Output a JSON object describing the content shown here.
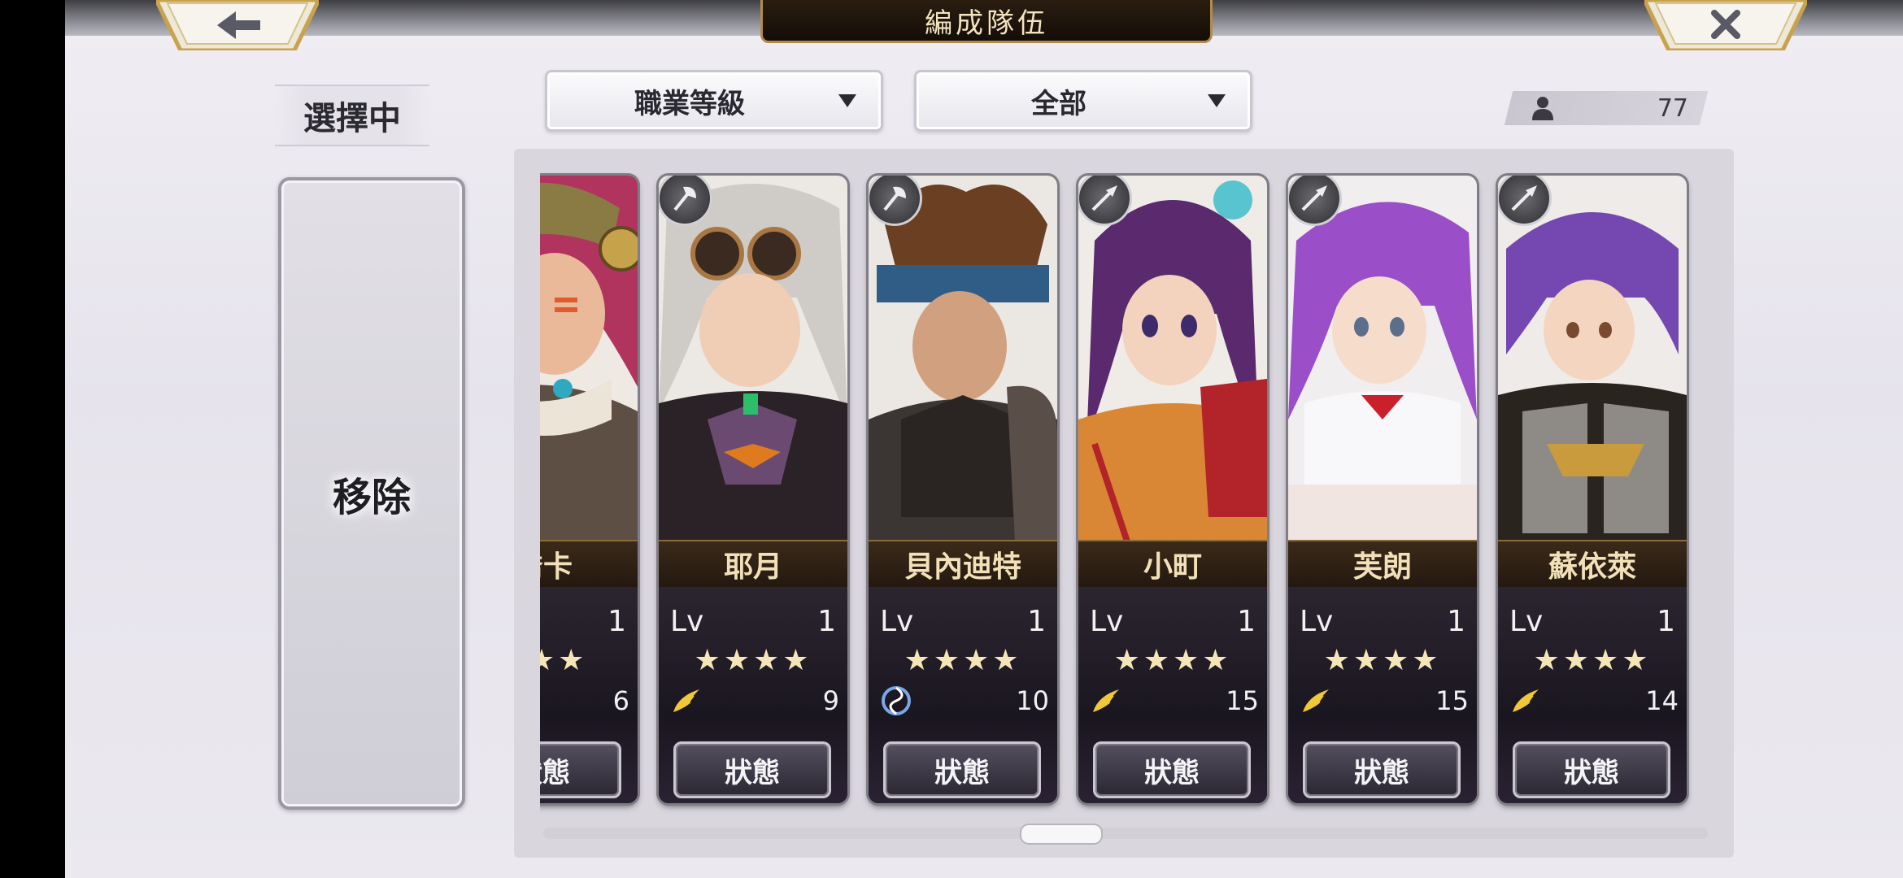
{
  "header": {
    "title": "編成隊伍",
    "back_icon": "back-arrow-icon",
    "close_icon": "close-x-icon"
  },
  "left_panel": {
    "selecting_label": "選擇中",
    "remove_label": "移除"
  },
  "filters": {
    "sort_label": "職業等級",
    "filter_label": "全部"
  },
  "unit_count": "77",
  "cards": [
    {
      "name": "喬卡",
      "lv_label": "",
      "lv": "1",
      "stars": "★★★",
      "stat_icon": "wing",
      "stat": "6",
      "status": "狀態",
      "emblem": "axe"
    },
    {
      "name": "耶月",
      "lv_label": "Lv",
      "lv": "1",
      "stars": "★★★★",
      "stat_icon": "wing",
      "stat": "9",
      "status": "狀態",
      "emblem": "axe"
    },
    {
      "name": "貝內迪特",
      "lv_label": "Lv",
      "lv": "1",
      "stars": "★★★★",
      "stat_icon": "swirl",
      "stat": "10",
      "status": "狀態",
      "emblem": "axe"
    },
    {
      "name": "小町",
      "lv_label": "Lv",
      "lv": "1",
      "stars": "★★★★",
      "stat_icon": "wing",
      "stat": "15",
      "status": "狀態",
      "emblem": "spear"
    },
    {
      "name": "芙朗",
      "lv_label": "Lv",
      "lv": "1",
      "stars": "★★★★",
      "stat_icon": "wing",
      "stat": "15",
      "status": "狀態",
      "emblem": "spear"
    },
    {
      "name": "蘇依萊",
      "lv_label": "Lv",
      "lv": "1",
      "stars": "★★★★",
      "stat_icon": "wing",
      "stat": "14",
      "status": "狀態",
      "emblem": "spear"
    }
  ],
  "colors": {
    "name_text": "#f2e0b8",
    "star": "#f5e6b7",
    "wing": "#f0c93a",
    "swirl": "#7aa8e6"
  }
}
